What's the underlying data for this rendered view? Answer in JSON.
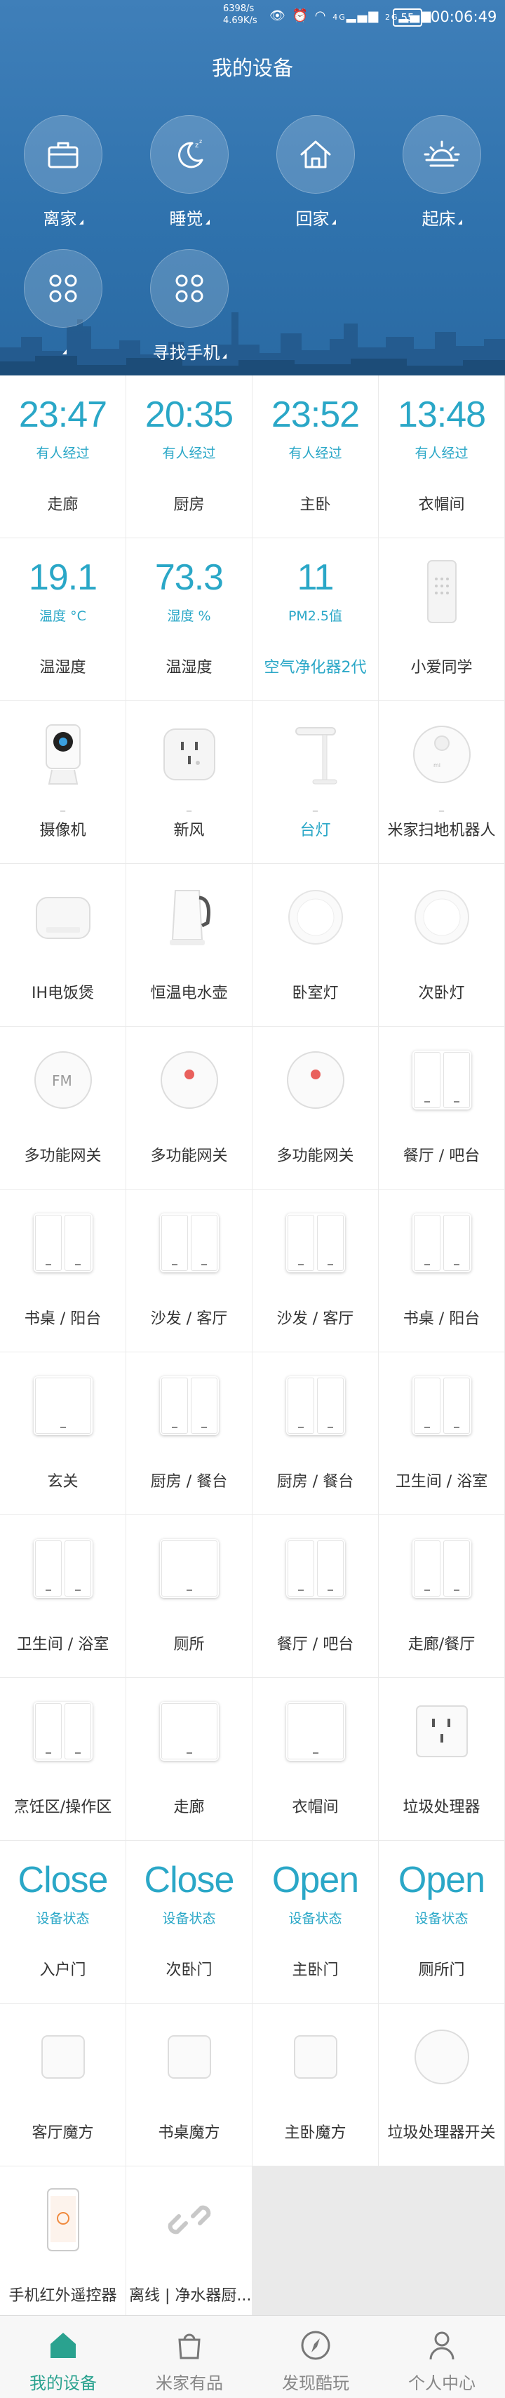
{
  "status_bar": {
    "net_speed_1": "6398/s",
    "net_speed_2": "4.69K/s",
    "signal_1": "4G",
    "signal_2": "2G",
    "battery": "55",
    "time": "00:06:49"
  },
  "header": {
    "title": "我的设备",
    "menu_icon": "menu-icon",
    "add_icon": "plus-icon"
  },
  "scenes": [
    {
      "label": "离家",
      "icon": "briefcase-icon"
    },
    {
      "label": "睡觉",
      "icon": "moon-sleep-icon"
    },
    {
      "label": "回家",
      "icon": "home-icon"
    },
    {
      "label": "起床",
      "icon": "sunrise-icon"
    },
    {
      "label": "",
      "icon": "grid-scene-icon"
    },
    {
      "label": "寻找手机",
      "icon": "grid-scene-icon"
    }
  ],
  "devices": [
    {
      "type": "value",
      "value": "23:47",
      "sub": "有人经过",
      "name": "走廊"
    },
    {
      "type": "value",
      "value": "20:35",
      "sub": "有人经过",
      "name": "厨房"
    },
    {
      "type": "value",
      "value": "23:52",
      "sub": "有人经过",
      "name": "主卧"
    },
    {
      "type": "value",
      "value": "13:48",
      "sub": "有人经过",
      "name": "衣帽间"
    },
    {
      "type": "value",
      "value": "19.1",
      "sub": "温度 °C",
      "name": "温湿度"
    },
    {
      "type": "value",
      "value": "73.3",
      "sub": "湿度 %",
      "name": "温湿度"
    },
    {
      "type": "value",
      "value": "11",
      "sub": "PM2.5值",
      "name": "空气净化器2代",
      "blue": true
    },
    {
      "type": "icon",
      "icon": "speaker-icon",
      "name": "小爱同学"
    },
    {
      "type": "icon",
      "icon": "camera-icon",
      "name": "摄像机",
      "dash": "–"
    },
    {
      "type": "icon",
      "icon": "socket-icon",
      "name": "新风",
      "dash": "–"
    },
    {
      "type": "icon",
      "icon": "desk-lamp-icon",
      "name": "台灯",
      "dash": "–",
      "blue": true
    },
    {
      "type": "icon",
      "icon": "robot-vacuum-icon",
      "name": "米家扫地机器人",
      "dash": "–"
    },
    {
      "type": "icon",
      "icon": "rice-cooker-icon",
      "name": "IH电饭煲"
    },
    {
      "type": "icon",
      "icon": "kettle-icon",
      "name": "恒温电水壶"
    },
    {
      "type": "icon",
      "icon": "ceiling-light-icon",
      "name": "卧室灯"
    },
    {
      "type": "icon",
      "icon": "ceiling-light-icon",
      "name": "次卧灯"
    },
    {
      "type": "icon",
      "icon": "gateway-fm-icon",
      "name": "多功能网关"
    },
    {
      "type": "icon",
      "icon": "gateway-icon",
      "name": "多功能网关"
    },
    {
      "type": "icon",
      "icon": "gateway-icon",
      "name": "多功能网关"
    },
    {
      "type": "switch",
      "keys": 2,
      "name": "餐厅 / 吧台"
    },
    {
      "type": "switch",
      "keys": 2,
      "name": "书桌 / 阳台"
    },
    {
      "type": "switch",
      "keys": 2,
      "name": "沙发 / 客厅"
    },
    {
      "type": "switch",
      "keys": 2,
      "name": "沙发 / 客厅"
    },
    {
      "type": "switch",
      "keys": 2,
      "name": "书桌 / 阳台"
    },
    {
      "type": "switch",
      "keys": 1,
      "name": "玄关"
    },
    {
      "type": "switch",
      "keys": 2,
      "name": "厨房 / 餐台"
    },
    {
      "type": "switch",
      "keys": 2,
      "name": "厨房 / 餐台"
    },
    {
      "type": "switch",
      "keys": 2,
      "name": "卫生间 / 浴室"
    },
    {
      "type": "switch",
      "keys": 2,
      "name": "卫生间 / 浴室"
    },
    {
      "type": "switch",
      "keys": 1,
      "name": "厕所"
    },
    {
      "type": "switch",
      "keys": 2,
      "name": "餐厅 / 吧台"
    },
    {
      "type": "switch",
      "keys": 2,
      "name": "走廊/餐厅"
    },
    {
      "type": "switch",
      "keys": 2,
      "name": "烹饪区/操作区"
    },
    {
      "type": "switch",
      "keys": 1,
      "name": "走廊"
    },
    {
      "type": "switch",
      "keys": 1,
      "name": "衣帽间"
    },
    {
      "type": "icon",
      "icon": "wall-socket-icon",
      "name": "垃圾处理器"
    },
    {
      "type": "value",
      "value": "Close",
      "sub": "设备状态",
      "name": "入户门"
    },
    {
      "type": "value",
      "value": "Close",
      "sub": "设备状态",
      "name": "次卧门"
    },
    {
      "type": "value",
      "value": "Open",
      "sub": "设备状态",
      "name": "主卧门"
    },
    {
      "type": "value",
      "value": "Open",
      "sub": "设备状态",
      "name": "厕所门"
    },
    {
      "type": "icon",
      "icon": "magic-cube-icon",
      "name": "客厅魔方"
    },
    {
      "type": "icon",
      "icon": "magic-cube-icon",
      "name": "书桌魔方"
    },
    {
      "type": "icon",
      "icon": "magic-cube-icon",
      "name": "主卧魔方"
    },
    {
      "type": "icon",
      "icon": "round-button-icon",
      "name": "垃圾处理器开关"
    },
    {
      "type": "icon",
      "icon": "phone-remote-icon",
      "name": "手机红外遥控器"
    },
    {
      "type": "icon",
      "icon": "chain-link-icon",
      "name": "离线 | 净水器厨..."
    }
  ],
  "tabs": [
    {
      "label": "我的设备",
      "icon": "home-tab-icon",
      "active": true
    },
    {
      "label": "米家有品",
      "icon": "shopping-bag-icon",
      "active": false
    },
    {
      "label": "发现酷玩",
      "icon": "compass-icon",
      "active": false
    },
    {
      "label": "个人中心",
      "icon": "person-icon",
      "active": false
    }
  ],
  "colors": {
    "header": "#2f72ad",
    "accent": "#2aa7c7",
    "tab_active": "#2aa28f"
  }
}
